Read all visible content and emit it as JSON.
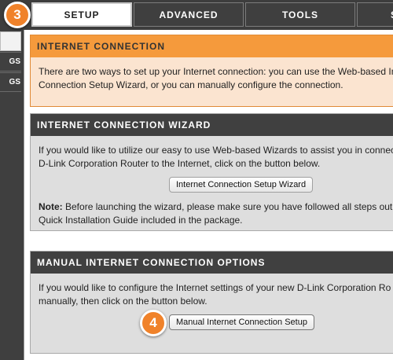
{
  "tabs": [
    {
      "label": "SETUP",
      "active": true
    },
    {
      "label": "ADVANCED",
      "active": false
    },
    {
      "label": "TOOLS",
      "active": false
    },
    {
      "label": "S",
      "active": false
    }
  ],
  "sidebar": {
    "items": [
      {
        "label": "",
        "active": true
      },
      {
        "label": "GS",
        "active": false
      },
      {
        "label": "GS",
        "active": false
      }
    ]
  },
  "callouts": {
    "step3": "3",
    "step4": "4"
  },
  "internet_connection": {
    "title": "INTERNET CONNECTION",
    "line1": "There are two ways to set up your Internet connection: you can use the Web-based Int",
    "line2": "Connection Setup Wizard, or you can manually configure the connection."
  },
  "wizard": {
    "title": "INTERNET CONNECTION WIZARD",
    "line1": "If you would like to utilize our easy to use Web-based Wizards to assist you in connec",
    "line2": "D-Link Corporation Router to the Internet, click on the button below.",
    "button_label": "Internet Connection Setup Wizard",
    "note_label": "Note:",
    "note_line1": " Before launching the wizard, please make sure you have followed all steps outli",
    "note_line2": "Quick Installation Guide included in the package."
  },
  "manual": {
    "title": "MANUAL INTERNET CONNECTION OPTIONS",
    "line1": "If you would like to configure the Internet settings of your new D-Link Corporation Ro",
    "line2": "manually, then click on the button below.",
    "button_label": "Manual Internet Connection Setup"
  },
  "colors": {
    "accent_orange": "#f59a3c",
    "dark_header": "#404040",
    "callout": "#f0822a"
  }
}
